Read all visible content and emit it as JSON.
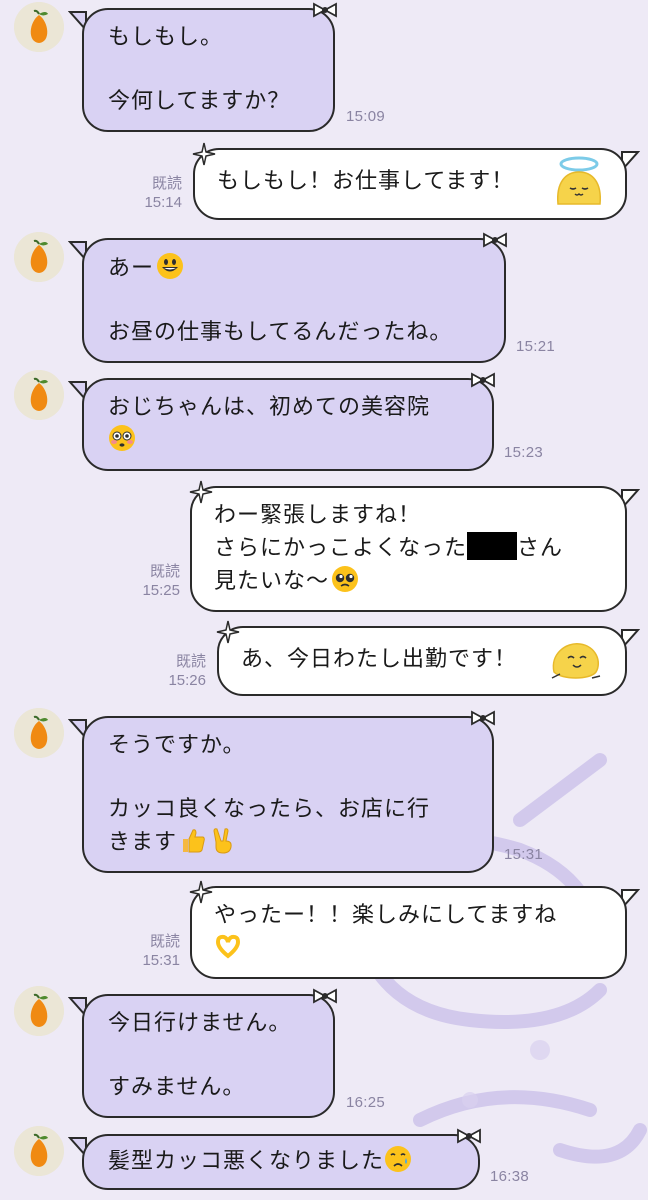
{
  "messages": [
    {
      "side": "in",
      "lines": [
        "もしもし。",
        "",
        "今何してますか？"
      ],
      "time": "15:09"
    },
    {
      "side": "out",
      "lines": [
        "もしもし！お仕事してます！"
      ],
      "read": "既読",
      "time": "15:14"
    },
    {
      "side": "in",
      "lines": [
        "あー",
        "",
        "お昼の仕事もしてるんだったね。"
      ],
      "time": "15:21"
    },
    {
      "side": "in",
      "lines": [
        "おじちゃんは、初めての美容院",
        ""
      ],
      "time": "15:23"
    },
    {
      "side": "out",
      "lines": [
        "わー緊張しますね！",
        "さらにかっこよくなった",
        "さん",
        "見たいな〜"
      ],
      "read": "既読",
      "time": "15:25"
    },
    {
      "side": "out",
      "lines": [
        "あ、今日わたし出勤です！"
      ],
      "read": "既読",
      "time": "15:26"
    },
    {
      "side": "in",
      "lines": [
        "そうですか。",
        "",
        "カッコ良くなったら、お店に行",
        "きます"
      ],
      "time": "15:31"
    },
    {
      "side": "out",
      "lines": [
        "やったー！！楽しみにしてますね",
        ""
      ],
      "read": "既読",
      "time": "15:31"
    },
    {
      "side": "in",
      "lines": [
        "今日行けません。",
        "",
        "すみません。"
      ],
      "time": "16:25"
    },
    {
      "side": "in",
      "lines": [
        "髪型カッコ悪くなりました"
      ],
      "time": "16:38"
    }
  ],
  "icons": {
    "avatar": "orange-fruit-icon",
    "grin": "grinning-face-emoji",
    "flushed": "flushed-face-emoji",
    "pleading": "pleading-face-emoji",
    "thumbs": "thumbs-up-emoji",
    "victory": "victory-hand-emoji",
    "hearthands": "heart-hands-emoji",
    "sad": "sad-but-relieved-face-emoji",
    "angel": "angel-blob-sticker",
    "blob": "happy-blob-sticker"
  },
  "colors": {
    "incoming_bubble": "#d9d2f3",
    "outgoing_bubble": "#ffffff",
    "background": "#eeeaf6",
    "meta_text": "#8a84a2"
  }
}
